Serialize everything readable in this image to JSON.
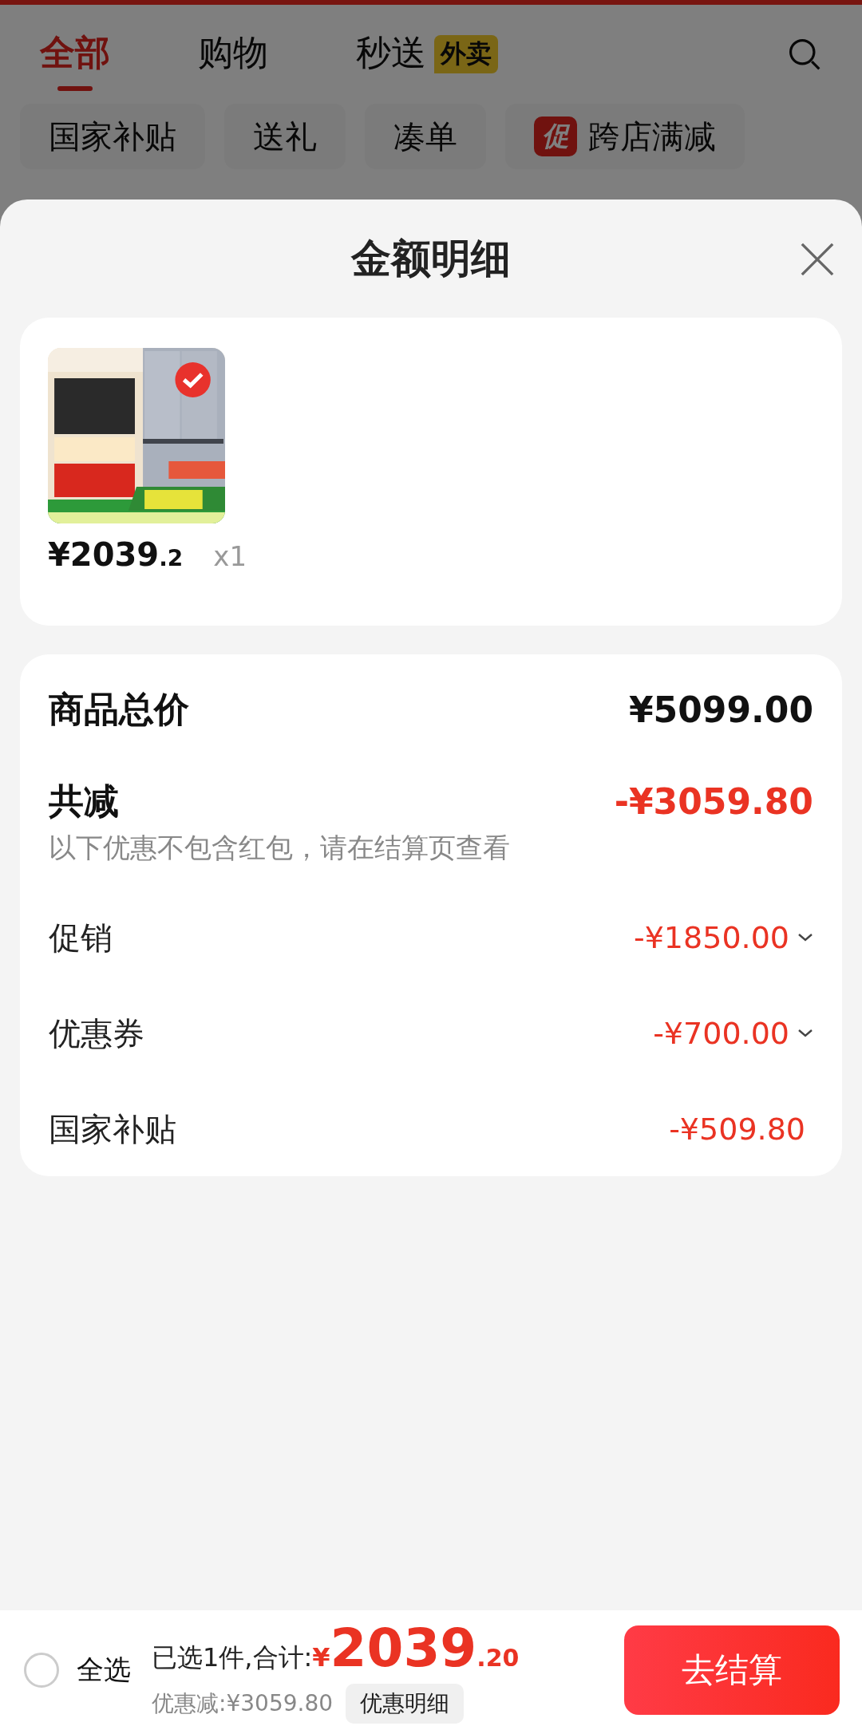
{
  "tabs": [
    {
      "label": "全部",
      "selected": true
    },
    {
      "label": "购物",
      "selected": false
    },
    {
      "label": "秒送",
      "selected": false,
      "badge": "外卖"
    }
  ],
  "chips": [
    {
      "label": "国家补贴"
    },
    {
      "label": "送礼"
    },
    {
      "label": "凑单"
    },
    {
      "label": "跨店满减",
      "tag": "促"
    }
  ],
  "sheet": {
    "title": "金额明细"
  },
  "item": {
    "kind": "picture",
    "price_main": "¥2039",
    "price_decimal": ".2",
    "quantity": "x1"
  },
  "summary": {
    "total_label": "商品总价",
    "total_value": "¥5099.00",
    "discount_label": "共减",
    "discount_value": "-¥3059.80",
    "note": "以下优惠不包含红包，请在结算页查看",
    "lines": [
      {
        "label": "促销",
        "value": "-¥1850.00",
        "kind": "expandable"
      },
      {
        "label": "优惠券",
        "value": "-¥700.00",
        "kind": "expandable"
      },
      {
        "label": "国家补贴",
        "value": "-¥509.80",
        "kind": "plain"
      }
    ]
  },
  "footer": {
    "select_all": {
      "label": "全选",
      "checked": false
    },
    "selected_text": "已选1件,合计:",
    "currency": "¥",
    "total_main": "2039",
    "total_decimal": ".20",
    "savings": "优惠减:¥3059.80",
    "details_button": "优惠明细",
    "checkout_button": "去结算"
  }
}
